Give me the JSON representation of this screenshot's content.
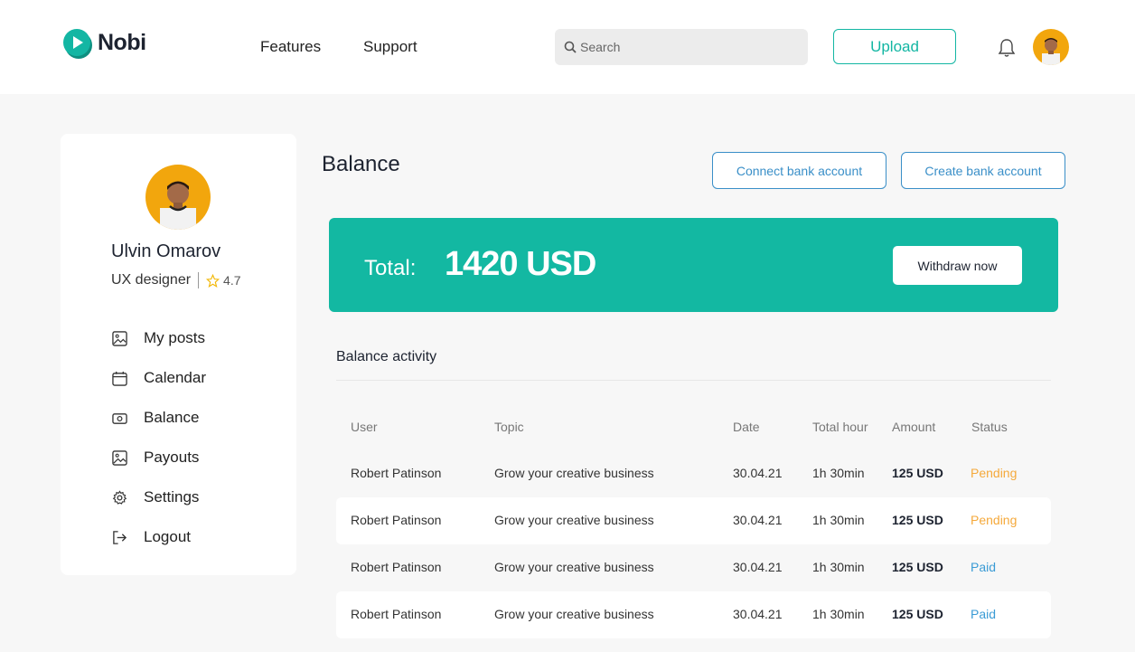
{
  "header": {
    "logo_text": "Nobi",
    "nav": [
      "Features",
      "Support"
    ],
    "search_placeholder": "Search",
    "upload_label": "Upload"
  },
  "profile": {
    "name": "Ulvin Omarov",
    "role": "UX designer",
    "rating": "4.7"
  },
  "menu": [
    {
      "label": "My posts",
      "icon": "image-icon"
    },
    {
      "label": "Calendar",
      "icon": "calendar-icon"
    },
    {
      "label": "Balance",
      "icon": "money-icon"
    },
    {
      "label": "Payouts",
      "icon": "image-icon"
    },
    {
      "label": "Settings",
      "icon": "gear-icon"
    },
    {
      "label": "Logout",
      "icon": "logout-icon"
    }
  ],
  "balance": {
    "title": "Balance",
    "connect_label": "Connect bank account",
    "create_label": "Create bank account",
    "total_label": "Total:",
    "total_value": "1420 USD",
    "withdraw_label": "Withdraw now",
    "activity_title": "Balance activity"
  },
  "table": {
    "headers": [
      "User",
      "Topic",
      "Date",
      "Total hour",
      "Amount",
      "Status"
    ],
    "rows": [
      {
        "user": "Robert Patinson",
        "topic": "Grow your creative business",
        "date": "30.04.21",
        "hours": "1h 30min",
        "amount": "125 USD",
        "status": "Pending"
      },
      {
        "user": "Robert Patinson",
        "topic": "Grow your creative business",
        "date": "30.04.21",
        "hours": "1h 30min",
        "amount": "125 USD",
        "status": "Pending"
      },
      {
        "user": "Robert Patinson",
        "topic": "Grow your creative business",
        "date": "30.04.21",
        "hours": "1h 30min",
        "amount": "125 USD",
        "status": "Paid"
      },
      {
        "user": "Robert Patinson",
        "topic": "Grow your creative business",
        "date": "30.04.21",
        "hours": "1h 30min",
        "amount": "125 USD",
        "status": "Paid"
      }
    ]
  },
  "colors": {
    "accent": "#13b8a2",
    "link_blue": "#3a8fc8",
    "pending": "#f5a93b",
    "paid": "#3a9bd5",
    "avatar_bg": "#f2a60d"
  }
}
